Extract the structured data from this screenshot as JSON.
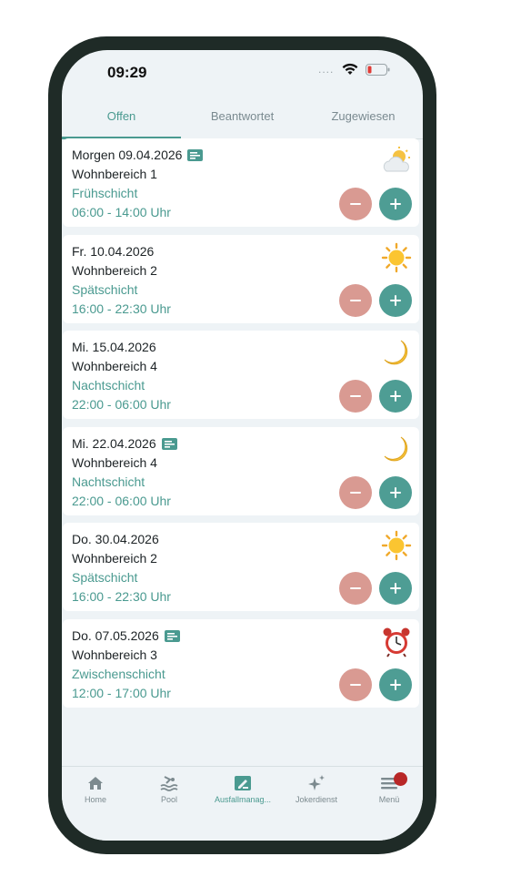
{
  "status_bar": {
    "time": "09:29",
    "signal": "...."
  },
  "tabs": [
    {
      "label": "Offen",
      "active": true
    },
    {
      "label": "Beantwortet",
      "active": false
    },
    {
      "label": "Zugewiesen",
      "active": false
    }
  ],
  "shifts": [
    {
      "date": "Morgen 09.04.2026",
      "area": "Wohnbereich 1",
      "shift": "Frühschicht",
      "time": "06:00 - 14:00 Uhr",
      "has_note": true,
      "icon": "cloud-sun-icon"
    },
    {
      "date": "Fr. 10.04.2026",
      "area": "Wohnbereich 2",
      "shift": "Spätschicht",
      "time": "16:00 - 22:30 Uhr",
      "has_note": false,
      "icon": "sun-icon"
    },
    {
      "date": "Mi. 15.04.2026",
      "area": "Wohnbereich 4",
      "shift": "Nachtschicht",
      "time": "22:00 - 06:00 Uhr",
      "has_note": false,
      "icon": "moon-icon"
    },
    {
      "date": "Mi. 22.04.2026",
      "area": "Wohnbereich 4",
      "shift": "Nachtschicht",
      "time": "22:00 - 06:00 Uhr",
      "has_note": true,
      "icon": "moon-icon"
    },
    {
      "date": "Do. 30.04.2026",
      "area": "Wohnbereich 2",
      "shift": "Spätschicht",
      "time": "16:00 - 22:30 Uhr",
      "has_note": false,
      "icon": "sun-icon"
    },
    {
      "date": "Do. 07.05.2026",
      "area": "Wohnbereich 3",
      "shift": "Zwischenschicht",
      "time": "12:00 - 17:00 Uhr",
      "has_note": true,
      "icon": "alarm-clock-icon"
    }
  ],
  "bottom_nav": [
    {
      "label": "Home",
      "icon": "home-icon",
      "active": false
    },
    {
      "label": "Pool",
      "icon": "pool-icon",
      "active": false
    },
    {
      "label": "Ausfallmanag...",
      "icon": "edit-note-icon",
      "active": true
    },
    {
      "label": "Jokerdienst",
      "icon": "sparkles-icon",
      "active": false
    },
    {
      "label": "Menü",
      "icon": "menu-icon",
      "active": false,
      "badge": true
    }
  ],
  "colors": {
    "accent": "#4a9a90",
    "minus": "#d99a92",
    "plus": "#4e9d94",
    "frame": "#1f2b27",
    "badge": "#b82727"
  }
}
